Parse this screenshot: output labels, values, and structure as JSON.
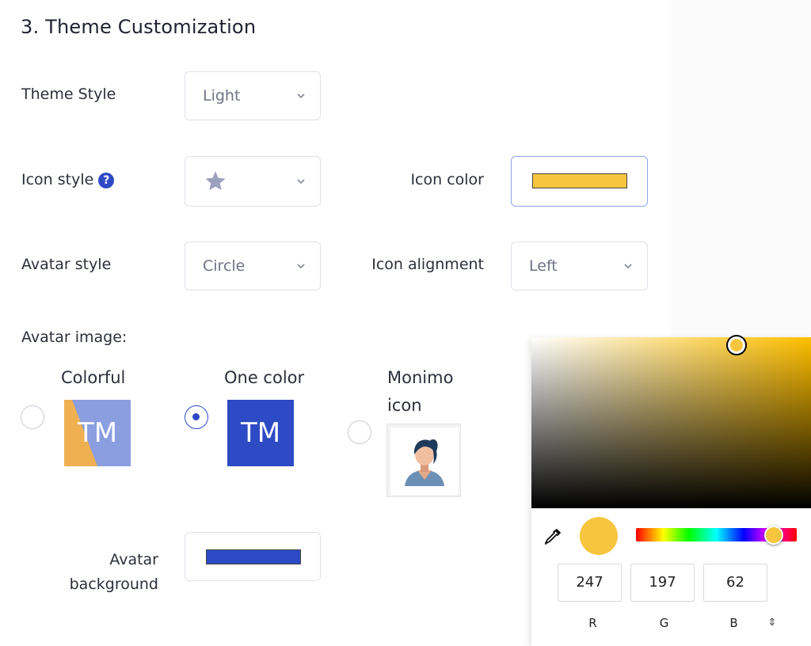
{
  "section": {
    "title": "3. Theme Customization"
  },
  "theme_style": {
    "label": "Theme Style",
    "value": "Light"
  },
  "icon_style": {
    "label": "Icon style",
    "help_glyph": "?",
    "value_icon": "star-icon"
  },
  "icon_color": {
    "label": "Icon color",
    "color": "#f7c53e"
  },
  "avatar_style": {
    "label": "Avatar style",
    "value": "Circle"
  },
  "icon_alignment": {
    "label": "Icon alignment",
    "value": "Left"
  },
  "avatar_image": {
    "label": "Avatar image:",
    "options": [
      {
        "label": "Colorful",
        "tile_text": "TM",
        "selected": false
      },
      {
        "label": "One color",
        "tile_text": "TM",
        "selected": true
      },
      {
        "label": "Monimo icon",
        "selected": false
      }
    ]
  },
  "avatar_background": {
    "label_line1": "Avatar",
    "label_line2": "background",
    "color": "#2d4bc4"
  },
  "color_picker": {
    "r": "247",
    "g": "197",
    "b": "62",
    "r_label": "R",
    "g_label": "G",
    "b_label": "B",
    "mode_toggle_glyph": "⇕",
    "current_color": "#f7c53e"
  },
  "colors": {
    "accent": "#2f49c6",
    "orange": "#efb052",
    "lavender": "#8a9ee0"
  }
}
